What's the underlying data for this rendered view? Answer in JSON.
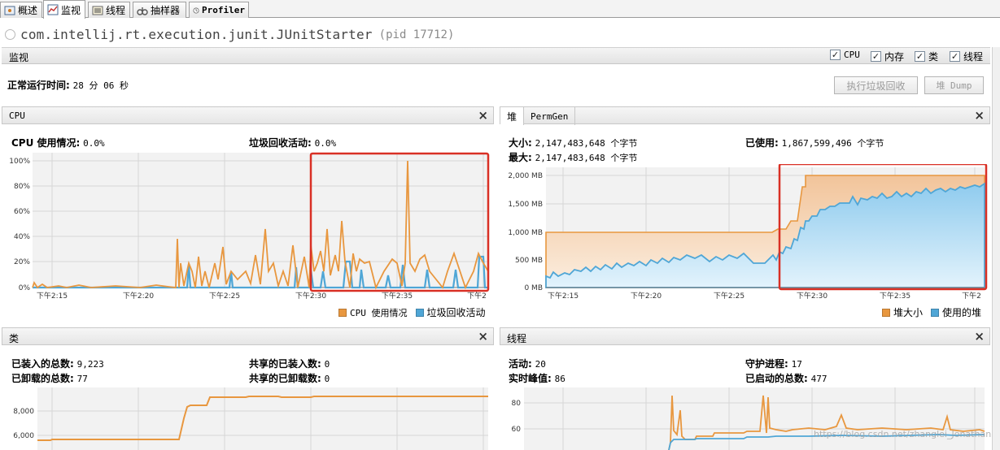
{
  "tabs": [
    {
      "label": "概述",
      "icon": "overview-icon"
    },
    {
      "label": "监视",
      "icon": "monitor-icon",
      "active": true
    },
    {
      "label": "线程",
      "icon": "threads-icon"
    },
    {
      "label": "抽样器",
      "icon": "sampler-icon"
    },
    {
      "label": "Profiler",
      "icon": "profiler-icon"
    }
  ],
  "title": {
    "app": "com.intellij.rt.execution.junit.JUnitStarter",
    "pid": "(pid 17712)"
  },
  "section": {
    "label": "监视",
    "checkboxes": [
      {
        "label": "CPU",
        "checked": true
      },
      {
        "label": "内存",
        "checked": true
      },
      {
        "label": "类",
        "checked": true
      },
      {
        "label": "线程",
        "checked": true
      }
    ]
  },
  "uptime": {
    "label": "正常运行时间:",
    "value": "28 分 06 秒"
  },
  "buttons": {
    "gc": "执行垃圾回收",
    "dump": "堆 Dump"
  },
  "colors": {
    "orange": "#e8973f",
    "blue": "#4fa6d6",
    "highlight": "#d93025"
  },
  "cpu_panel": {
    "title": "CPU",
    "cpu_usage_label": "CPU 使用情况:",
    "cpu_usage_value": "0.0%",
    "gc_label": "垃圾回收活动:",
    "gc_value": "0.0%",
    "legend": [
      "CPU 使用情况",
      "垃圾回收活动"
    ],
    "y_ticks": [
      "100%",
      "80%",
      "60%",
      "40%",
      "20%",
      "0%"
    ],
    "x_ticks": [
      "下午2:15",
      "下午2:20",
      "下午2:25",
      "下午2:30",
      "下午2:35",
      "下午2"
    ]
  },
  "heap_panel": {
    "tabs": [
      "堆",
      "PermGen"
    ],
    "size_label": "大小:",
    "size_value": "2,147,483,648 个字节",
    "max_label": "最大:",
    "max_value": "2,147,483,648 个字节",
    "used_label": "已使用:",
    "used_value": "1,867,599,496 个字节",
    "legend": [
      "堆大小",
      "使用的堆"
    ],
    "y_ticks": [
      "2,000 MB",
      "1,500 MB",
      "1,000 MB",
      "500 MB",
      "0 MB"
    ],
    "x_ticks": [
      "下午2:15",
      "下午2:20",
      "下午2:25",
      "下午2:30",
      "下午2:35",
      "下午2"
    ]
  },
  "classes_panel": {
    "title": "类",
    "loaded_label": "已装入的总数:",
    "loaded_value": "9,223",
    "unloaded_label": "已卸载的总数:",
    "unloaded_value": "77",
    "shared_loaded_label": "共享的已装入数:",
    "shared_loaded_value": "0",
    "shared_unloaded_label": "共享的已卸载数:",
    "shared_unloaded_value": "0",
    "y_ticks": [
      "8,000",
      "6,000"
    ]
  },
  "threads_panel": {
    "title": "线程",
    "live_label": "活动:",
    "live_value": "20",
    "peak_label": "实时峰值:",
    "peak_value": "86",
    "daemon_label": "守护进程:",
    "daemon_value": "17",
    "started_label": "已启动的总数:",
    "started_value": "477",
    "y_ticks": [
      "80",
      "60"
    ]
  },
  "watermark": "https://blog.csdn.net/zhanglei_Jonathan"
}
